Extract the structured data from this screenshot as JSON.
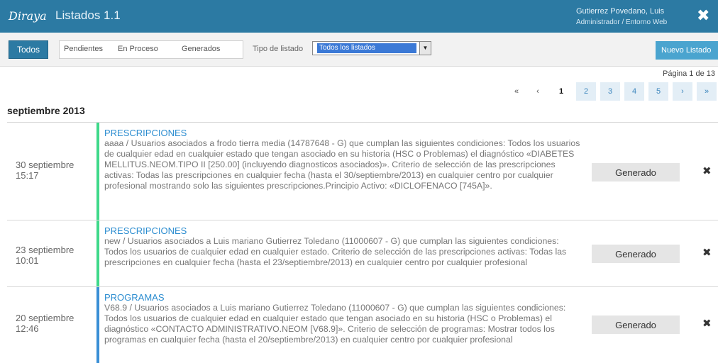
{
  "header": {
    "logo": "Diraya",
    "title": "Listados 1.1",
    "user_name": "Gutierrez Povedano, Luis",
    "user_role": "Administrador / Entorno Web",
    "close_glyph": "✖"
  },
  "toolbar": {
    "todos_label": "Todos",
    "filters": [
      "Pendientes",
      "En Proceso",
      "Generados"
    ],
    "tipo_label": "Tipo de listado",
    "tipo_value": "Todos los listados",
    "nuevo_label": "Nuevo Listado"
  },
  "pagination": {
    "info": "Página 1 de 13",
    "first": "«",
    "prev": "‹",
    "pages": [
      "1",
      "2",
      "3",
      "4",
      "5"
    ],
    "current_page": "1",
    "next": "›",
    "last": "»"
  },
  "month_heading": "septiembre 2013",
  "records": [
    {
      "day": "30 septiembre",
      "time": "15:17",
      "category": "PRESCRIPCIONES",
      "bar_color": "#3fd98a",
      "description": "aaaa / Usuarios asociados a frodo tierra media (14787648 - G) que cumplan las siguientes condiciones: Todos los usuarios de cualquier edad en cualquier estado que tengan asociado en su historia (HSC o Problemas) el diagnóstico «DIABETES MELLITUS.NEOM.TIPO II [250.00] (incluyendo diagnosticos asociados)». Criterio de selección de las prescripciones activas: Todas las prescripciones en cualquier fecha (hasta el 30/septiembre/2013) en cualquier centro por cualquier profesional mostrando solo las siguientes prescripciones.Principio Activo: «DICLOFENACO [745A]».",
      "status": "Generado",
      "delete_glyph": "✖"
    },
    {
      "day": "23 septiembre",
      "time": "10:01",
      "category": "PRESCRIPCIONES",
      "bar_color": "#3fd98a",
      "description": "new / Usuarios asociados a Luis mariano Gutierrez Toledano (11000607 - G) que cumplan las siguientes condiciones: Todos los usuarios de cualquier edad en cualquier estado. Criterio de selección de las prescripciones activas: Todas las prescripciones en cualquier fecha (hasta el 23/septiembre/2013) en cualquier centro por cualquier profesional",
      "status": "Generado",
      "delete_glyph": "✖"
    },
    {
      "day": "20 septiembre",
      "time": "12:46",
      "category": "PROGRAMAS",
      "bar_color": "#3a8fd6",
      "description": "V68.9 / Usuarios asociados a Luis mariano Gutierrez Toledano (11000607 - G) que cumplan las siguientes condiciones: Todos los usuarios de cualquier edad en cualquier estado que tengan asociado en su historia (HSC o Problemas) el diagnóstico «CONTACTO ADMINISTRATIVO.NEOM [V68.9]». Criterio de selección de programas: Mostrar todos los programas en cualquier fecha (hasta el 20/septiembre/2013) en cualquier centro por cualquier profesional",
      "status": "Generado",
      "delete_glyph": "✖"
    }
  ]
}
